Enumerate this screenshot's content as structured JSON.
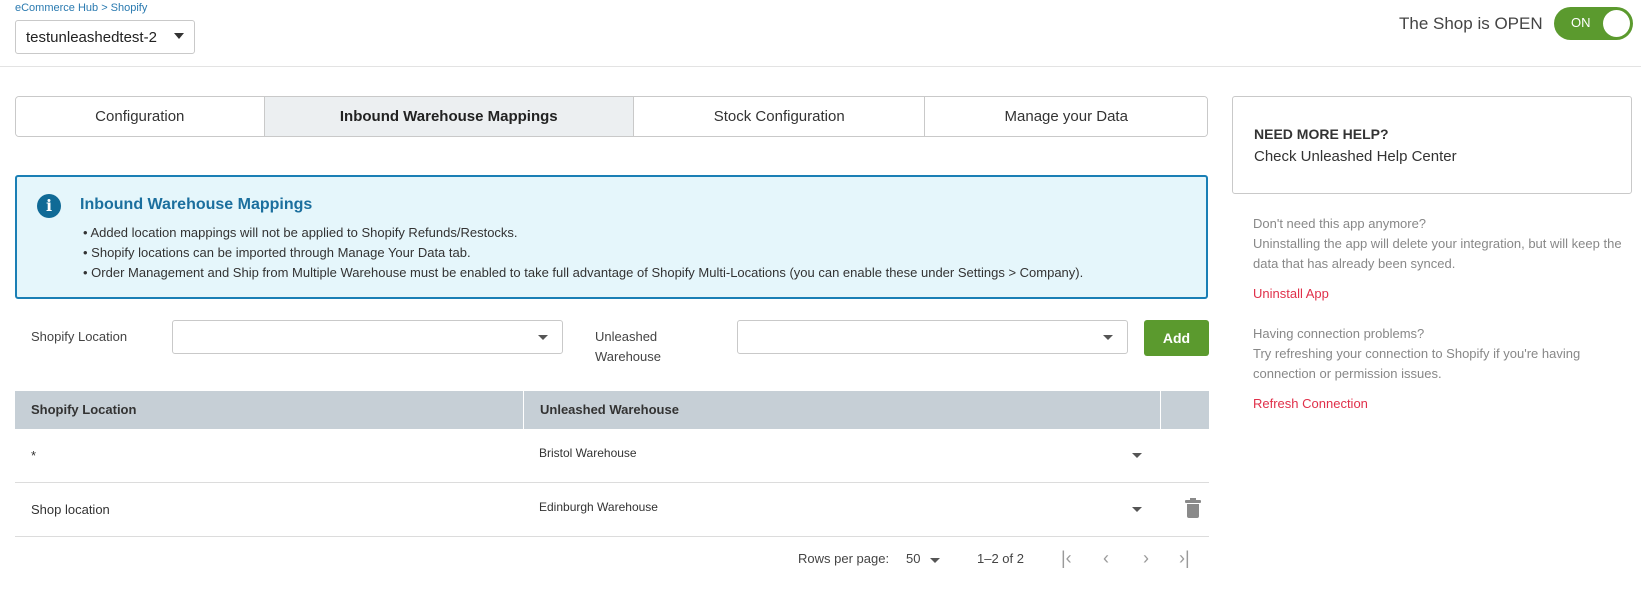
{
  "header": {
    "breadcrumb": "eCommerce Hub > Shopify",
    "store_name": "testunleashedtest-2",
    "shop_status": "The Shop is OPEN",
    "toggle_label": "ON"
  },
  "tabs": [
    {
      "label": "Configuration",
      "active": false
    },
    {
      "label": "Inbound Warehouse Mappings",
      "active": true
    },
    {
      "label": "Stock Configuration",
      "active": false
    },
    {
      "label": "Manage your Data",
      "active": false
    }
  ],
  "info": {
    "title": "Inbound Warehouse Mappings",
    "lines": [
      "• Added location mappings will not be applied to Shopify Refunds/Restocks.",
      "• Shopify locations can be imported through Manage Your Data tab.",
      "• Order Management and Ship from Multiple Warehouse must be enabled to take full advantage of Shopify Multi-Locations (you can enable these under Settings > Company)."
    ]
  },
  "form": {
    "shopify_location_label": "Shopify Location",
    "shopify_location_value": "",
    "unleashed_warehouse_label": "Unleashed Warehouse",
    "unleashed_warehouse_value": "",
    "add_label": "Add"
  },
  "table": {
    "columns": [
      "Shopify Location",
      "Unleashed Warehouse"
    ],
    "rows": [
      {
        "location": "*",
        "warehouse": "Bristol Warehouse",
        "deletable": false
      },
      {
        "location": "Shop location",
        "warehouse": "Edinburgh Warehouse",
        "deletable": true
      }
    ]
  },
  "pagination": {
    "rows_per_page_label": "Rows per page:",
    "rows_per_page_value": "50",
    "range": "1–2 of 2"
  },
  "help": {
    "title": "NEED MORE HELP?",
    "link": "Check Unleashed Help Center",
    "uninstall_heading": "Don't need this app anymore?",
    "uninstall_text": "Uninstalling the app will delete your integration, but will keep the data that has already been synced.",
    "uninstall_link": "Uninstall App",
    "connection_heading": "Having connection problems?",
    "connection_text": "Try refreshing your connection to Shopify if you're having connection or permission issues.",
    "refresh_link": "Refresh Connection"
  },
  "colors": {
    "accent_green": "#5b9a2e",
    "info_border": "#1a7fb5",
    "info_bg": "#e5f6fb",
    "link_red": "#e0304a",
    "table_header": "#c6cfd6"
  }
}
